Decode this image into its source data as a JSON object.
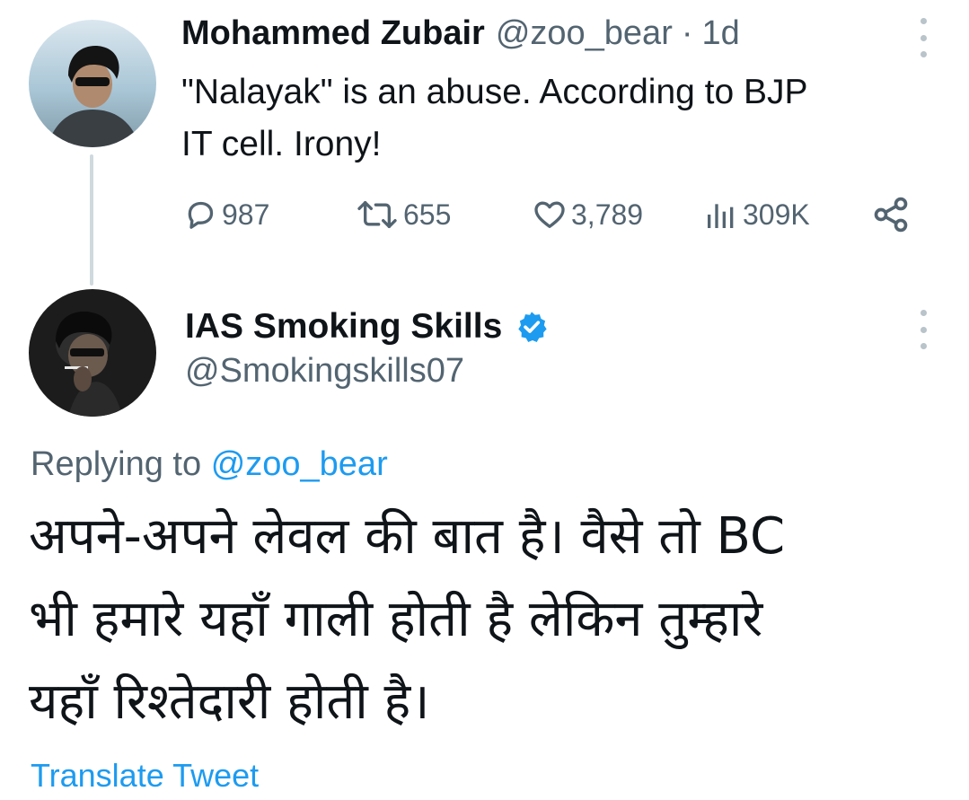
{
  "tweet1": {
    "author_name": "Mohammed Zubair",
    "handle": "@zoo_bear",
    "separator": "·",
    "time": "1d",
    "text_line1": "\"Nalayak\" is an abuse. According to BJP",
    "text_line2": "IT cell. Irony!",
    "stats": {
      "replies": "987",
      "retweets": "655",
      "likes": "3,789",
      "views": "309K"
    }
  },
  "tweet2": {
    "author_name": "IAS Smoking Skills",
    "handle": "@Smokingskills07",
    "replying_prefix": "Replying to",
    "replying_handle": "@zoo_bear",
    "text_line1": "अपने-अपने लेवल की बात है। वैसे तो BC",
    "text_line2": "भी हमारे यहाँ गाली होती है लेकिन तुम्हारे",
    "text_line3": "यहाँ रिश्तेदारी होती है।",
    "translate_label": "Translate Tweet"
  },
  "icons": {
    "reply": "speech-bubble-icon",
    "retweet": "retweet-icon",
    "like": "heart-icon",
    "views": "bar-chart-icon",
    "share": "share-icon",
    "more": "more-vertical-icon",
    "verified": "verified-badge-icon"
  },
  "colors": {
    "text": "#0f1419",
    "muted": "#536471",
    "link": "#1d9bf0",
    "thread_line": "#cfd9de"
  }
}
